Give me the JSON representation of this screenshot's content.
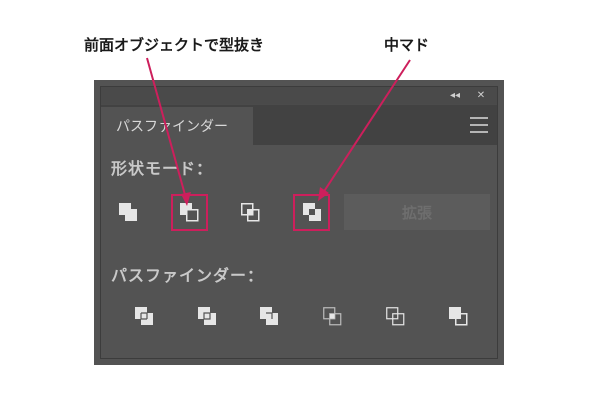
{
  "annotations": {
    "left": "前面オブジェクトで型抜き",
    "right": "中マド",
    "highlight_color": "#cd1f5c"
  },
  "titlebar": {
    "collapse_glyph": "◂◂",
    "close_glyph": "✕"
  },
  "tab": {
    "label": "パスファインダー"
  },
  "sections": {
    "shape_modes": "形状モード：",
    "pathfinders": "パスファインダー："
  },
  "shape_mode_buttons": [
    {
      "icon": "unite-icon"
    },
    {
      "icon": "minus-front-icon",
      "highlighted": true
    },
    {
      "icon": "intersect-icon"
    },
    {
      "icon": "exclude-icon",
      "highlighted": true
    }
  ],
  "expand_button": {
    "label": "拡張",
    "enabled": false
  },
  "pathfinder_buttons": [
    {
      "icon": "divide-icon"
    },
    {
      "icon": "trim-icon"
    },
    {
      "icon": "merge-icon"
    },
    {
      "icon": "crop-icon"
    },
    {
      "icon": "outline-icon"
    },
    {
      "icon": "minus-back-icon"
    }
  ],
  "colors": {
    "panel_bg": "#535353",
    "tab_bar": "#424242",
    "text": "#c9c9c9",
    "icon_fill": "#e6e6e6"
  }
}
